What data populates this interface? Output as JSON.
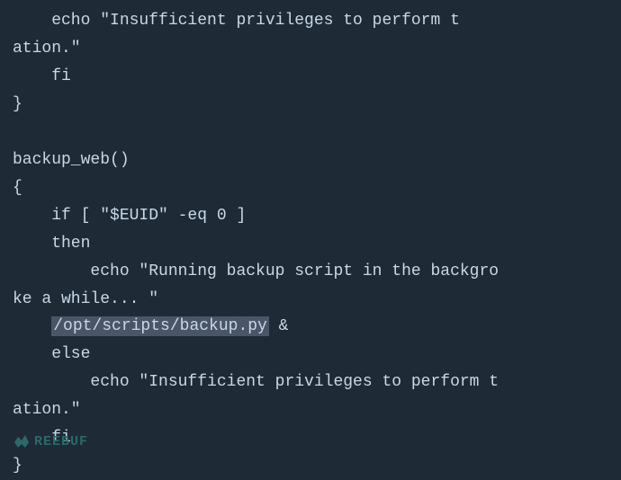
{
  "code": {
    "lines": [
      {
        "id": "line1",
        "parts": [
          {
            "text": "    echo \"Insufficient privileges to perform t",
            "type": "normal"
          }
        ]
      },
      {
        "id": "line2",
        "parts": [
          {
            "text": "ation.\"",
            "type": "normal"
          }
        ]
      },
      {
        "id": "line3",
        "parts": [
          {
            "text": "    fi",
            "type": "normal"
          }
        ]
      },
      {
        "id": "line4",
        "parts": [
          {
            "text": "}",
            "type": "normal"
          }
        ]
      },
      {
        "id": "line5",
        "parts": [
          {
            "text": "",
            "type": "normal"
          }
        ]
      },
      {
        "id": "line6",
        "parts": [
          {
            "text": "backup_web()",
            "type": "normal"
          }
        ]
      },
      {
        "id": "line7",
        "parts": [
          {
            "text": "{",
            "type": "normal"
          }
        ]
      },
      {
        "id": "line8",
        "parts": [
          {
            "text": "    if [ \"$EUID\" -eq 0 ]",
            "type": "normal"
          }
        ]
      },
      {
        "id": "line9",
        "parts": [
          {
            "text": "    then",
            "type": "normal"
          }
        ]
      },
      {
        "id": "line10",
        "parts": [
          {
            "text": "        echo \"Running backup script in the backgro",
            "type": "normal"
          }
        ]
      },
      {
        "id": "line11",
        "parts": [
          {
            "text": "ke a while... \"",
            "type": "normal"
          }
        ]
      },
      {
        "id": "line12",
        "parts": [
          {
            "text": "    ",
            "type": "normal"
          },
          {
            "text": "/opt/scripts/backup.py",
            "type": "highlight"
          },
          {
            "text": " &",
            "type": "normal"
          }
        ]
      },
      {
        "id": "line13",
        "parts": [
          {
            "text": "    else",
            "type": "normal"
          }
        ]
      },
      {
        "id": "line14",
        "parts": [
          {
            "text": "        echo \"Insufficient privileges to perform t",
            "type": "normal"
          }
        ]
      },
      {
        "id": "line15",
        "parts": [
          {
            "text": "ation.\"",
            "type": "normal"
          }
        ]
      },
      {
        "id": "line16",
        "parts": [
          {
            "text": "    fi",
            "type": "normal"
          }
        ]
      },
      {
        "id": "line17",
        "parts": [
          {
            "text": "}",
            "type": "normal"
          }
        ]
      }
    ],
    "watermark_text": "REEBUF"
  }
}
